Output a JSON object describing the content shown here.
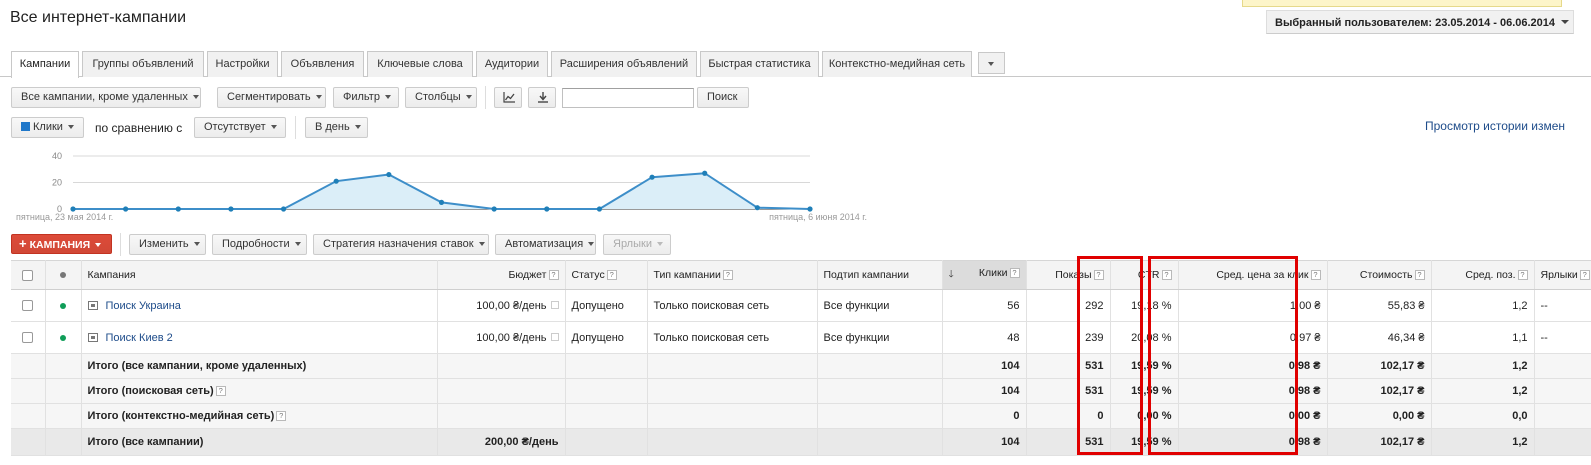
{
  "page_title": "Все интернет-кампании",
  "date_range_label": "Выбранный пользователем: 23.05.2014 - 06.06.2014",
  "tabs": [
    {
      "label": "Кампании",
      "active": true
    },
    {
      "label": "Группы объявлений"
    },
    {
      "label": "Настройки"
    },
    {
      "label": "Объявления"
    },
    {
      "label": "Ключевые слова"
    },
    {
      "label": "Аудитории"
    },
    {
      "label": "Расширения объявлений"
    },
    {
      "label": "Быстрая статистика"
    },
    {
      "label": "Контекстно-медийная сеть"
    }
  ],
  "toolbar": {
    "view_filter": "Все кампании, кроме удаленных",
    "segment": "Сегментировать",
    "filter": "Фильтр",
    "columns": "Столбцы",
    "search_value": "",
    "search_button": "Поиск"
  },
  "chart_controls": {
    "metric": "Клики",
    "compare_label": "по сравнению с",
    "compare_value": "Отсутствует",
    "granularity": "В день",
    "history_link": "Просмотр истории измен"
  },
  "chart_data": {
    "type": "area",
    "x": [
      "23.05",
      "24.05",
      "25.05",
      "26.05",
      "27.05",
      "28.05",
      "29.05",
      "30.05",
      "31.05",
      "01.06",
      "02.06",
      "03.06",
      "04.06",
      "05.06",
      "06.06"
    ],
    "series": [
      {
        "values": [
          0,
          0,
          0,
          0,
          0,
          21,
          26,
          5,
          0,
          0,
          0,
          24,
          27,
          1,
          0
        ]
      }
    ],
    "yticks": [
      "40",
      "20",
      "0"
    ],
    "ylim": [
      0,
      40
    ],
    "start_label": "пятница, 23 мая 2014 г.",
    "end_label": "пятница, 6 июня 2014 г.",
    "grid": true,
    "color": "#3d8ec9"
  },
  "actions": {
    "campaign": "КАМПАНИЯ",
    "edit": "Изменить",
    "details": "Подробности",
    "bidding": "Стратегия назначения ставок",
    "automate": "Автоматизация",
    "labels": "Ярлыки"
  },
  "table": {
    "headers": {
      "campaign": "Кампания",
      "budget": "Бюджет",
      "status": "Статус",
      "type": "Тип кампании",
      "subtype": "Подтип кампании",
      "clicks": "Клики",
      "impressions": "Показы",
      "ctr": "CTR",
      "avg_cpc": "Сред. цена за клик",
      "cost": "Стоимость",
      "avg_pos": "Сред. поз.",
      "labels": "Ярлыки"
    },
    "rows": [
      {
        "campaign": "Поиск Украина",
        "budget": "100,00 ₴/день",
        "status": "Допущено",
        "type": "Только поисковая сеть",
        "subtype": "Все функции",
        "clicks": "56",
        "impressions": "292",
        "ctr": "19,18 %",
        "avg_cpc": "1,00 ₴",
        "cost": "55,83 ₴",
        "avg_pos": "1,2",
        "labels": "--"
      },
      {
        "campaign": "Поиск Киев 2",
        "budget": "100,00 ₴/день",
        "status": "Допущено",
        "type": "Только поисковая сеть",
        "subtype": "Все функции",
        "clicks": "48",
        "impressions": "239",
        "ctr": "20,08 %",
        "avg_cpc": "0,97 ₴",
        "cost": "46,34 ₴",
        "avg_pos": "1,1",
        "labels": "--"
      }
    ],
    "totals": [
      {
        "label": "Итого (все кампании, кроме удаленных)",
        "budget": "",
        "clicks": "104",
        "impressions": "531",
        "ctr": "19,59 %",
        "avg_cpc": "0,98 ₴",
        "cost": "102,17 ₴",
        "avg_pos": "1,2"
      },
      {
        "label": "Итого (поисковая сеть)",
        "budget": "",
        "clicks": "104",
        "impressions": "531",
        "ctr": "19,59 %",
        "avg_cpc": "0,98 ₴",
        "cost": "102,17 ₴",
        "avg_pos": "1,2"
      },
      {
        "label": "Итого (контекстно-медийная сеть)",
        "budget": "",
        "clicks": "0",
        "impressions": "0",
        "ctr": "0,00 %",
        "avg_cpc": "0,00 ₴",
        "cost": "0,00 ₴",
        "avg_pos": "0,0"
      },
      {
        "label": "Итого (все кампании)",
        "budget": "200,00 ₴/день",
        "clicks": "104",
        "impressions": "531",
        "ctr": "19,59 %",
        "avg_cpc": "0,98 ₴",
        "cost": "102,17 ₴",
        "avg_pos": "1,2"
      }
    ]
  },
  "colors": {
    "accent_red": "#d14836",
    "highlight_red": "#e00000",
    "status_green": "#0f9d58",
    "link_blue": "#1e4c8a"
  }
}
